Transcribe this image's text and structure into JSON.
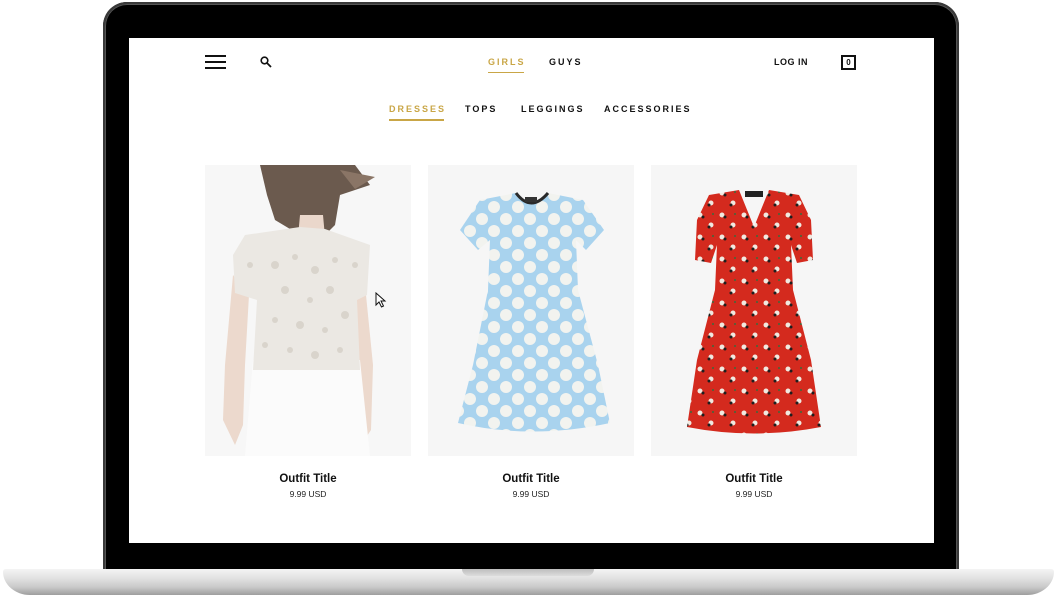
{
  "header": {
    "menu_icon": "hamburger-menu-icon",
    "search_icon": "search-icon",
    "genders": [
      {
        "label": "GIRLS",
        "active": true
      },
      {
        "label": "GUYS",
        "active": false
      }
    ],
    "login_label": "LOG IN",
    "cart_count": "0"
  },
  "categories": [
    {
      "label": "DRESSES",
      "active": true
    },
    {
      "label": "TOPS",
      "active": false
    },
    {
      "label": "LEGGINGS",
      "active": false
    },
    {
      "label": "ACCESSORIES",
      "active": false
    }
  ],
  "products": [
    {
      "title": "Outfit Title",
      "price": "9.99 USD",
      "image": "lace-top-photo"
    },
    {
      "title": "Outfit Title",
      "price": "9.99 USD",
      "image": "polka-dot-dress-photo"
    },
    {
      "title": "Outfit Title",
      "price": "9.99 USD",
      "image": "red-floral-dress-photo"
    }
  ],
  "colors": {
    "accent": "#c9a646",
    "text": "#111111",
    "dress_blue": "#a9d3ee",
    "dress_red": "#d42a1e"
  }
}
